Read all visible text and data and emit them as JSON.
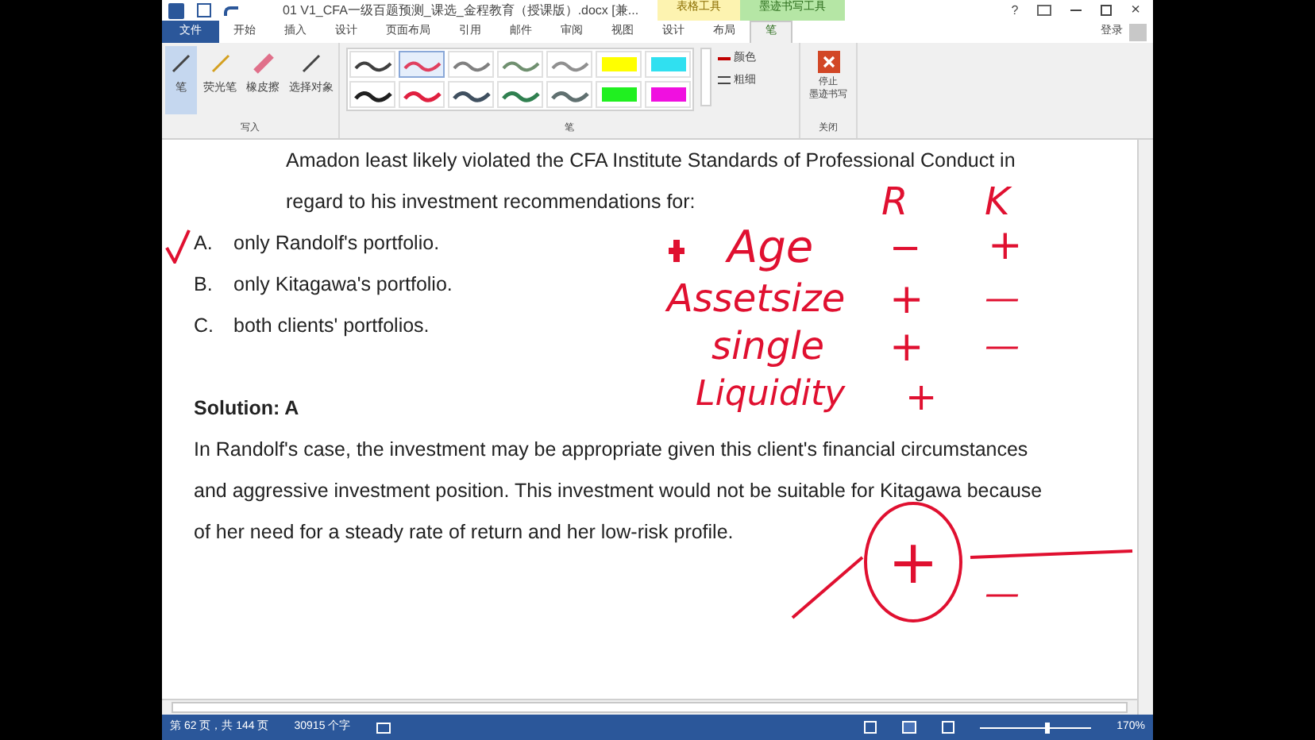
{
  "window": {
    "title": "01 V1_CFA一级百题预测_课选_金程教育（授课版）.docx [兼...",
    "contextual_tabs": [
      {
        "label": "表格工具",
        "kind": "table"
      },
      {
        "label": "墨迹书写工具",
        "kind": "ink"
      }
    ],
    "controls": [
      "?",
      "×"
    ],
    "sign_in": "登录"
  },
  "tabs": [
    {
      "label": "文件",
      "kind": "file",
      "selected": false
    },
    {
      "label": "开始",
      "selected": false
    },
    {
      "label": "插入",
      "selected": false
    },
    {
      "label": "设计",
      "selected": false
    },
    {
      "label": "页面布局",
      "selected": false
    },
    {
      "label": "引用",
      "selected": false
    },
    {
      "label": "邮件",
      "selected": false
    },
    {
      "label": "审阅",
      "selected": false
    },
    {
      "label": "视图",
      "selected": false
    },
    {
      "label": "设计",
      "selected": false
    },
    {
      "label": "布局",
      "selected": false
    },
    {
      "label": "笔",
      "selected": true
    }
  ],
  "ribbon": {
    "write_group": {
      "label": "写入",
      "tools": [
        {
          "label": "笔",
          "selected": true
        },
        {
          "label": "荧光笔",
          "selected": false
        },
        {
          "label": "橡皮擦",
          "selected": false
        },
        {
          "label": "选择对象",
          "selected": false
        }
      ]
    },
    "pen_group": {
      "label": "笔",
      "pens": [
        {
          "color": "#404040",
          "selected": false
        },
        {
          "color": "#e04060",
          "selected": true
        },
        {
          "color": "#808080",
          "selected": false
        },
        {
          "color": "#709070",
          "selected": false
        },
        {
          "color": "#909090",
          "selected": false
        },
        {
          "color": "#ffff00",
          "selected": false
        },
        {
          "color": "#30e0f0",
          "selected": false
        },
        {
          "color": "#202020",
          "selected": false
        },
        {
          "color": "#e02040",
          "selected": false
        },
        {
          "color": "#405060",
          "selected": false
        },
        {
          "color": "#308050",
          "selected": false
        },
        {
          "color": "#607070",
          "selected": false
        },
        {
          "color": "#20f020",
          "selected": false
        },
        {
          "color": "#f010e0",
          "selected": false
        }
      ],
      "color_label": "颜色",
      "thickness_label": "粗细"
    },
    "close_group": {
      "label": "关闭",
      "button_lines": [
        "停止",
        "墨迹书写"
      ]
    }
  },
  "document": {
    "question_lines": [
      "Amadon least likely violated the CFA Institute Standards of Professional Conduct in",
      "regard to his investment recommendations for:"
    ],
    "options": [
      {
        "letter": "A.",
        "text": "only Randolf's portfolio."
      },
      {
        "letter": "B.",
        "text": "only Kitagawa's portfolio."
      },
      {
        "letter": "C.",
        "text": "both clients' portfolios."
      }
    ],
    "solution_title": "Solution: A",
    "solution_lines": [
      "In Randolf's case, the investment may be appropriate given this client's financial circumstances",
      "and aggressive investment position. This investment would not be suitable for Kitagawa because",
      "of her need for a steady rate of return and her low-risk profile."
    ]
  },
  "ink": [
    "R",
    "K",
    "Age",
    "−",
    "+",
    "Assetsize",
    "+",
    "—",
    "single",
    "+",
    "—",
    "Liquidity",
    "+",
    "+",
    "—"
  ],
  "status_bar": {
    "page": "第 62 页，共 144 页",
    "words": "30915 个字",
    "zoom": "170%",
    "zoom_slider": {
      "level": 0.58
    }
  }
}
